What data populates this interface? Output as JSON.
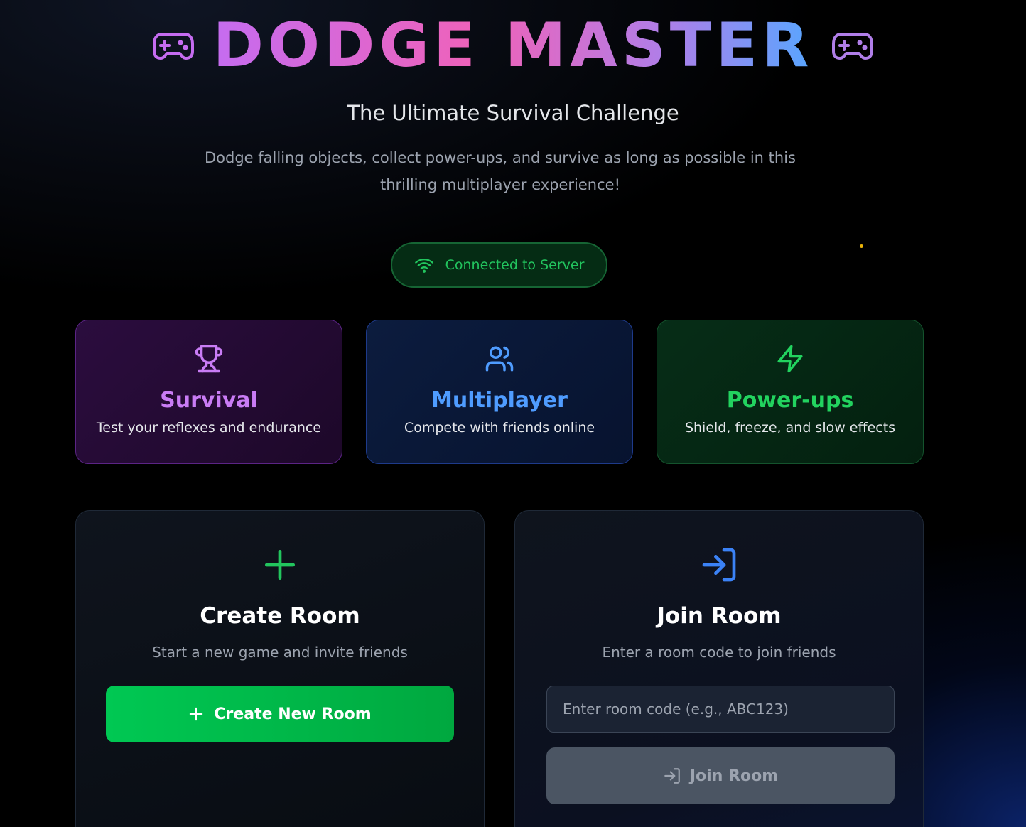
{
  "header": {
    "title": "DODGE MASTER",
    "subtitle": "The Ultimate Survival Challenge",
    "description": "Dodge falling objects, collect power-ups, and survive as long as possible in this thrilling multiplayer experience!",
    "left_icon": "gamepad-icon",
    "right_icon": "gamepad-icon"
  },
  "status": {
    "label": "Connected to Server",
    "icon": "wifi-icon",
    "color": "#22c55e"
  },
  "features": [
    {
      "title": "Survival",
      "description": "Test your reflexes and endurance",
      "icon": "trophy-icon",
      "color": "#c97cf5"
    },
    {
      "title": "Multiplayer",
      "description": "Compete with friends online",
      "icon": "users-icon",
      "color": "#4f9cff"
    },
    {
      "title": "Power-ups",
      "description": "Shield, freeze, and slow effects",
      "icon": "lightning-icon",
      "color": "#22d35f"
    }
  ],
  "create_room": {
    "title": "Create Room",
    "description": "Start a new game and invite friends",
    "button_label": "Create New Room",
    "icon": "plus-icon",
    "color": "#00c853"
  },
  "join_room": {
    "title": "Join Room",
    "description": "Enter a room code to join friends",
    "input_placeholder": "Enter room code (e.g., ABC123)",
    "input_value": "",
    "button_label": "Join Room",
    "icon": "login-icon",
    "color": "#3b82f6"
  },
  "theme": {
    "title_gradient": [
      "#c56cf0",
      "#f062b8",
      "#58a6ff"
    ],
    "background": "#000000"
  }
}
